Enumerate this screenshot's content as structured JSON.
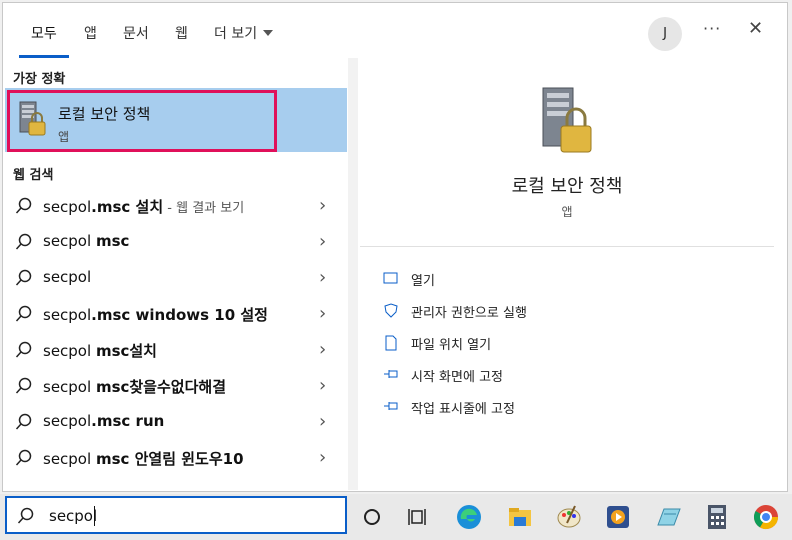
{
  "tabs": [
    {
      "label": "모두",
      "active": true
    },
    {
      "label": "앱"
    },
    {
      "label": "문서"
    },
    {
      "label": "웹"
    },
    {
      "label": "더 보기"
    }
  ],
  "header": {
    "avatar_initial": "J",
    "more_label": "···",
    "close_label": "✕"
  },
  "left": {
    "best_match_header": "가장 정확",
    "best_match": {
      "title": "로컬 보안 정책",
      "subtitle": "앱",
      "icon": "security-policy-icon"
    },
    "web_search_header": "웹 검색",
    "results": [
      {
        "prefix": "secpol",
        "bold": ".msc 설치",
        "hint": " - 웹 결과 보기"
      },
      {
        "prefix": "secpol ",
        "bold": "msc",
        "hint": ""
      },
      {
        "prefix": "secpol",
        "bold": "",
        "hint": ""
      },
      {
        "prefix": "secpol",
        "bold": ".msc windows 10 설정",
        "hint": ""
      },
      {
        "prefix": "secpol ",
        "bold": "msc설치",
        "hint": ""
      },
      {
        "prefix": "secpol ",
        "bold": "msc찾을수없다해결",
        "hint": ""
      },
      {
        "prefix": "secpol",
        "bold": ".msc run",
        "hint": ""
      },
      {
        "prefix": "secpol ",
        "bold": "msc 안열림 윈도우10",
        "hint": ""
      }
    ]
  },
  "right": {
    "title": "로컬 보안 정책",
    "subtitle": "앱",
    "actions": [
      {
        "label": "열기",
        "icon": "open-icon"
      },
      {
        "label": "관리자 권한으로 실행",
        "icon": "shield-icon"
      },
      {
        "label": "파일 위치 열기",
        "icon": "file-location-icon"
      },
      {
        "label": "시작 화면에 고정",
        "icon": "pin-icon"
      },
      {
        "label": "작업 표시줄에 고정",
        "icon": "pin-icon"
      }
    ]
  },
  "search": {
    "value": "secpol"
  },
  "taskbar_icons": [
    "cortana-icon",
    "task-view-icon",
    "edge-icon",
    "file-explorer-icon",
    "paint-icon",
    "media-player-icon",
    "notepad-icon",
    "calculator-icon",
    "chrome-icon"
  ],
  "colors": {
    "accent": "#0a5ec8",
    "highlight": "#a7cdee",
    "outline": "#e0105a"
  }
}
